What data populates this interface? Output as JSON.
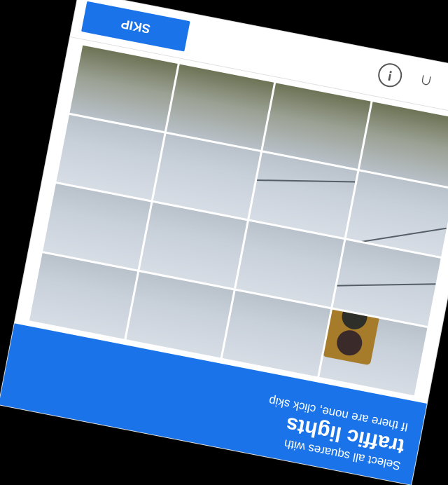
{
  "header": {
    "instruction": "Select all squares with",
    "target": "traffic lights",
    "hint": "If there are none, click skip"
  },
  "grid": {
    "rows": 4,
    "cols": 4
  },
  "footer": {
    "icons": [
      "refresh-icon",
      "headphones-icon",
      "info-icon"
    ],
    "skip_label": "SKIP"
  },
  "colors": {
    "accent": "#1a73e8",
    "background": "#000000"
  }
}
